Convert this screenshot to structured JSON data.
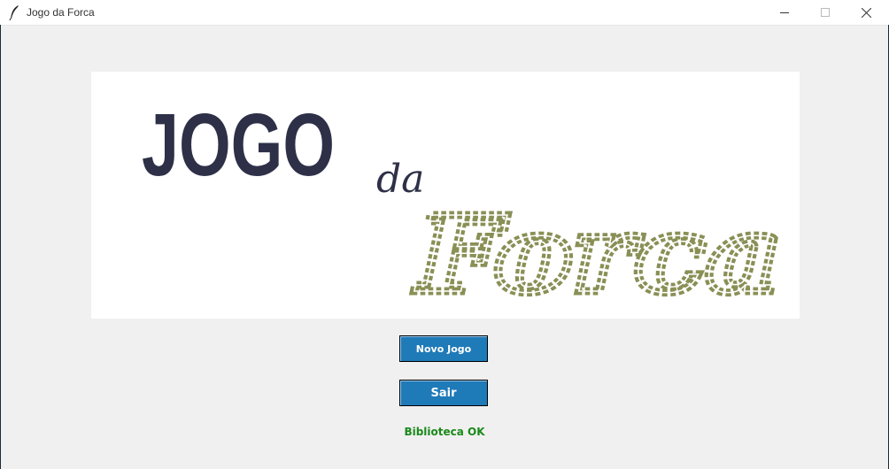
{
  "window": {
    "title": "Jogo da Forca",
    "icon": "feather-icon",
    "controls": [
      "minimize-icon",
      "maximize-icon",
      "close-icon"
    ]
  },
  "banner": {
    "word_jogo": "JOGO",
    "word_da": "da",
    "word_forca": "Forca",
    "colors": {
      "jogo": "#2e3048",
      "da": "#2e3048",
      "forca": "#8a8f55"
    }
  },
  "buttons": {
    "new_game": "Novo Jogo",
    "exit": "Sair",
    "color": "#1f7ab8"
  },
  "status": {
    "text": "Biblioteca OK",
    "color": "#1a8a1a"
  }
}
